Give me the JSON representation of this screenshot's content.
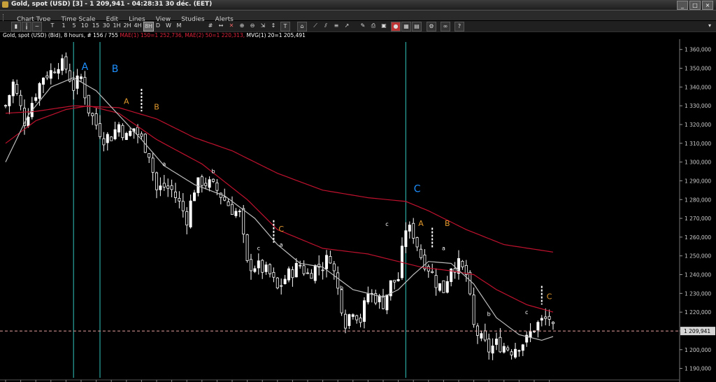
{
  "window": {
    "title": "Gold, spot (USD) [3] - 1 209,941 - 04:28:31  30 déc. (EET)",
    "buttons": [
      "_",
      "□",
      "×"
    ]
  },
  "menu": [
    "Chart Type",
    "Time Scale",
    "Edit",
    "Lines",
    "View",
    "Studies",
    "Alerts"
  ],
  "toolbar": {
    "timeframes": [
      "T",
      "1",
      "5",
      "10",
      "15",
      "30",
      "1H",
      "2H",
      "4H",
      "8H",
      "D",
      "W",
      "M"
    ],
    "selected_timeframe": "8H"
  },
  "info": {
    "prefix": "Gold, spot (USD) (Bid), 8 hours, # 156 / 755",
    "ma1": "MAE(1) 150=1 252,736,",
    "ma2": "MAE(2) 50=1 220,313,",
    "ma3": "MVG(1) 20=1 205,491"
  },
  "colors": {
    "background": "#000000",
    "candle": "#ffffff",
    "ma_red": "#c0122e",
    "ma_gray": "#bdbdbd",
    "cycle_lines": "#2aa6a0",
    "cycle_labels": "#1e90ff",
    "orange_labels": "#e39a2d",
    "price_line": "#e8a0a0"
  },
  "chart_data": {
    "type": "candlestick",
    "instrument": "Gold, spot (USD)",
    "timeframe": "8 hours",
    "last_price": "1 209,941",
    "y_ticks": [
      "1 360,000",
      "1 350,000",
      "1 340,000",
      "1 330,000",
      "1 320,000",
      "1 310,000",
      "1 300,000",
      "1 290,000",
      "1 280,000",
      "1 270,000",
      "1 260,000",
      "1 250,000",
      "1 240,000",
      "1 230,000",
      "1 220,000",
      "1 210,000",
      "1 200,000",
      "1 190,000"
    ],
    "y_tick_values": [
      1360,
      1350,
      1340,
      1330,
      1320,
      1310,
      1300,
      1290,
      1280,
      1270,
      1260,
      1250,
      1240,
      1230,
      1220,
      1210,
      1200,
      1190
    ],
    "ylim": [
      1185,
      1364
    ],
    "bar_count": 146,
    "ohlc_close_anchors": [
      [
        0,
        1330
      ],
      [
        2,
        1342
      ],
      [
        5,
        1322
      ],
      [
        8,
        1337
      ],
      [
        10,
        1346
      ],
      [
        12,
        1348
      ],
      [
        14,
        1353
      ],
      [
        16,
        1350
      ],
      [
        18,
        1340
      ],
      [
        20,
        1345
      ],
      [
        22,
        1328
      ],
      [
        24,
        1320
      ],
      [
        26,
        1313
      ],
      [
        28,
        1314
      ],
      [
        30,
        1320
      ],
      [
        32,
        1313
      ],
      [
        34,
        1318
      ],
      [
        36,
        1312
      ],
      [
        38,
        1305
      ],
      [
        40,
        1285
      ],
      [
        42,
        1287
      ],
      [
        44,
        1285
      ],
      [
        46,
        1278
      ],
      [
        48,
        1270
      ],
      [
        50,
        1286
      ],
      [
        52,
        1290
      ],
      [
        54,
        1288
      ],
      [
        56,
        1285
      ],
      [
        58,
        1280
      ],
      [
        60,
        1275
      ],
      [
        62,
        1272
      ],
      [
        64,
        1245
      ],
      [
        66,
        1245
      ],
      [
        68,
        1243
      ],
      [
        70,
        1240
      ],
      [
        72,
        1232
      ],
      [
        74,
        1238
      ],
      [
        76,
        1242
      ],
      [
        78,
        1245
      ],
      [
        80,
        1240
      ],
      [
        82,
        1244
      ],
      [
        84,
        1245
      ],
      [
        86,
        1250
      ],
      [
        88,
        1232
      ],
      [
        90,
        1215
      ],
      [
        92,
        1222
      ],
      [
        94,
        1216
      ],
      [
        96,
        1230
      ],
      [
        98,
        1228
      ],
      [
        100,
        1225
      ],
      [
        102,
        1235
      ],
      [
        104,
        1238
      ],
      [
        106,
        1265
      ],
      [
        108,
        1262
      ],
      [
        110,
        1250
      ],
      [
        112,
        1244
      ],
      [
        114,
        1236
      ],
      [
        116,
        1232
      ],
      [
        118,
        1245
      ],
      [
        120,
        1245
      ],
      [
        122,
        1240
      ],
      [
        124,
        1212
      ],
      [
        126,
        1205
      ],
      [
        128,
        1200
      ],
      [
        130,
        1203
      ],
      [
        132,
        1202
      ],
      [
        134,
        1200
      ],
      [
        136,
        1203
      ],
      [
        138,
        1205
      ],
      [
        140,
        1212
      ],
      [
        142,
        1215
      ],
      [
        144,
        1217
      ],
      [
        145,
        1210
      ]
    ],
    "series": [
      {
        "name": "MAE(1) 150=1",
        "color": "#c0122e",
        "points": [
          [
            0,
            1326
          ],
          [
            8,
            1327
          ],
          [
            18,
            1330
          ],
          [
            30,
            1329
          ],
          [
            40,
            1323
          ],
          [
            50,
            1313
          ],
          [
            60,
            1306
          ],
          [
            72,
            1294
          ],
          [
            84,
            1285
          ],
          [
            96,
            1281
          ],
          [
            106,
            1279
          ],
          [
            112,
            1274
          ],
          [
            122,
            1264
          ],
          [
            132,
            1256
          ],
          [
            145,
            1252
          ]
        ]
      },
      {
        "name": "MAE(2) 50=1",
        "color": "#c0122e",
        "points": [
          [
            0,
            1310
          ],
          [
            8,
            1322
          ],
          [
            16,
            1328
          ],
          [
            22,
            1330
          ],
          [
            30,
            1326
          ],
          [
            40,
            1312
          ],
          [
            52,
            1299
          ],
          [
            64,
            1280
          ],
          [
            72,
            1264
          ],
          [
            84,
            1254
          ],
          [
            96,
            1251
          ],
          [
            104,
            1247
          ],
          [
            110,
            1244
          ],
          [
            118,
            1242
          ],
          [
            124,
            1240
          ],
          [
            130,
            1232
          ],
          [
            138,
            1224
          ],
          [
            145,
            1220
          ]
        ]
      },
      {
        "name": "MVG(1) 20=1",
        "color": "#bdbdbd",
        "points": [
          [
            0,
            1300
          ],
          [
            6,
            1325
          ],
          [
            12,
            1340
          ],
          [
            18,
            1345
          ],
          [
            24,
            1338
          ],
          [
            30,
            1325
          ],
          [
            36,
            1312
          ],
          [
            42,
            1298
          ],
          [
            50,
            1288
          ],
          [
            58,
            1282
          ],
          [
            66,
            1270
          ],
          [
            72,
            1256
          ],
          [
            78,
            1246
          ],
          [
            84,
            1244
          ],
          [
            92,
            1232
          ],
          [
            100,
            1228
          ],
          [
            104,
            1232
          ],
          [
            108,
            1240
          ],
          [
            112,
            1247
          ],
          [
            118,
            1246
          ],
          [
            124,
            1235
          ],
          [
            130,
            1217
          ],
          [
            136,
            1208
          ],
          [
            142,
            1205
          ],
          [
            145,
            1207
          ]
        ]
      }
    ],
    "vertical_lines": [
      {
        "bar": 18
      },
      {
        "bar": 25
      },
      {
        "bar": 106
      }
    ],
    "labels": [
      {
        "text": "A",
        "bar": 21,
        "price": 1349,
        "color": "#1e90ff"
      },
      {
        "text": "B",
        "bar": 29,
        "price": 1348,
        "color": "#1e90ff"
      },
      {
        "text": "A",
        "bar": 32,
        "price": 1331,
        "color": "#e39a2d"
      },
      {
        "text": "B",
        "bar": 40,
        "price": 1328,
        "color": "#e39a2d"
      },
      {
        "text": "a",
        "bar": 42,
        "price": 1298,
        "color": "#ffffff"
      },
      {
        "text": "b",
        "bar": 55,
        "price": 1294,
        "color": "#ffffff"
      },
      {
        "text": "C",
        "bar": 73,
        "price": 1263,
        "color": "#e39a2d"
      },
      {
        "text": "c",
        "bar": 67,
        "price": 1253,
        "color": "#ffffff"
      },
      {
        "text": "a",
        "bar": 73,
        "price": 1255,
        "color": "#ffffff"
      },
      {
        "text": "b",
        "bar": 89,
        "price": 1232,
        "color": "#ffffff"
      },
      {
        "text": "C",
        "bar": 109,
        "price": 1284,
        "color": "#1e90ff"
      },
      {
        "text": "c",
        "bar": 101,
        "price": 1266,
        "color": "#ffffff"
      },
      {
        "text": "A",
        "bar": 110,
        "price": 1266,
        "color": "#e39a2d"
      },
      {
        "text": "B",
        "bar": 117,
        "price": 1266,
        "color": "#e39a2d"
      },
      {
        "text": "a",
        "bar": 116,
        "price": 1253,
        "color": "#ffffff"
      },
      {
        "text": "b",
        "bar": 128,
        "price": 1218,
        "color": "#ffffff"
      },
      {
        "text": "c",
        "bar": 138,
        "price": 1219,
        "color": "#ffffff"
      },
      {
        "text": "C",
        "bar": 144,
        "price": 1227,
        "color": "#e39a2d"
      }
    ],
    "dashed_marks": [
      {
        "bar": 36,
        "from": 1327,
        "to": 1339
      },
      {
        "bar": 71,
        "from": 1257,
        "to": 1269
      },
      {
        "bar": 113,
        "from": 1254,
        "to": 1265
      },
      {
        "bar": 142,
        "from": 1224,
        "to": 1234
      }
    ],
    "grid": false
  }
}
